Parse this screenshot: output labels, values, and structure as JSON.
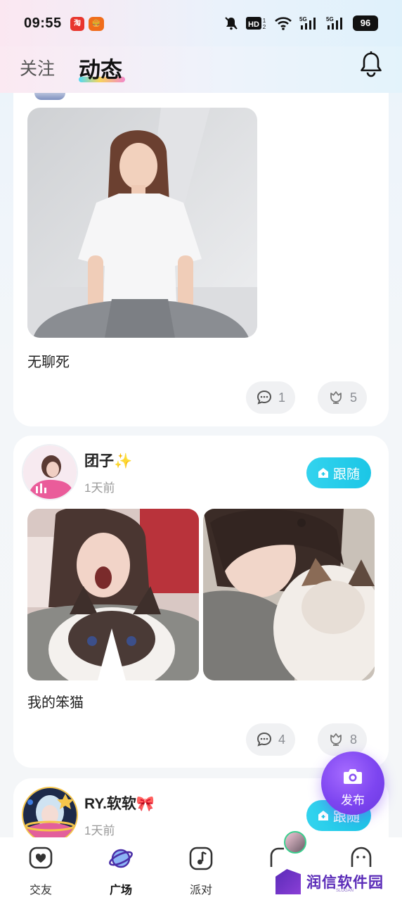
{
  "status_bar": {
    "time": "09:55",
    "app_badges": [
      "淘",
      "🍔"
    ],
    "signal_labels": [
      "HD",
      "5G",
      "5G"
    ],
    "battery": "96",
    "icons": [
      "mute-icon",
      "hd-icon",
      "wifi-icon",
      "signal-5g-icon",
      "signal-5g-icon",
      "battery-icon"
    ]
  },
  "header": {
    "tabs": [
      {
        "label": "关注",
        "active": false
      },
      {
        "label": "动态",
        "active": true
      }
    ],
    "bell_icon": "bell-icon"
  },
  "feed": {
    "posts": [
      {
        "caption": "无聊死",
        "comments": "1",
        "likes": "5"
      },
      {
        "username": "团子✨",
        "time": "1天前",
        "follow_label": "跟随",
        "caption": "我的笨猫",
        "comments": "4",
        "likes": "8"
      },
      {
        "username": "RY.软软🎀",
        "time": "1天前",
        "follow_label": "跟随"
      }
    ]
  },
  "fab": {
    "label": "发布",
    "icon": "camera-icon"
  },
  "bottom_nav": {
    "items": [
      {
        "label": "交友",
        "icon": "heart-chat-icon",
        "active": false
      },
      {
        "label": "广场",
        "icon": "planet-icon",
        "active": true
      },
      {
        "label": "派对",
        "icon": "music-note-icon",
        "active": false
      },
      {
        "label": "",
        "icon": "message-icon",
        "active": false
      },
      {
        "label": "",
        "icon": "profile-icon",
        "active": false
      }
    ]
  },
  "watermark": {
    "text": "润信软件园",
    "sub": "SLOGAN"
  },
  "colors": {
    "accent_cyan": "#1bc6e6",
    "fab_purple": "#7d45f0",
    "pill_bg": "#f0f1f3"
  }
}
